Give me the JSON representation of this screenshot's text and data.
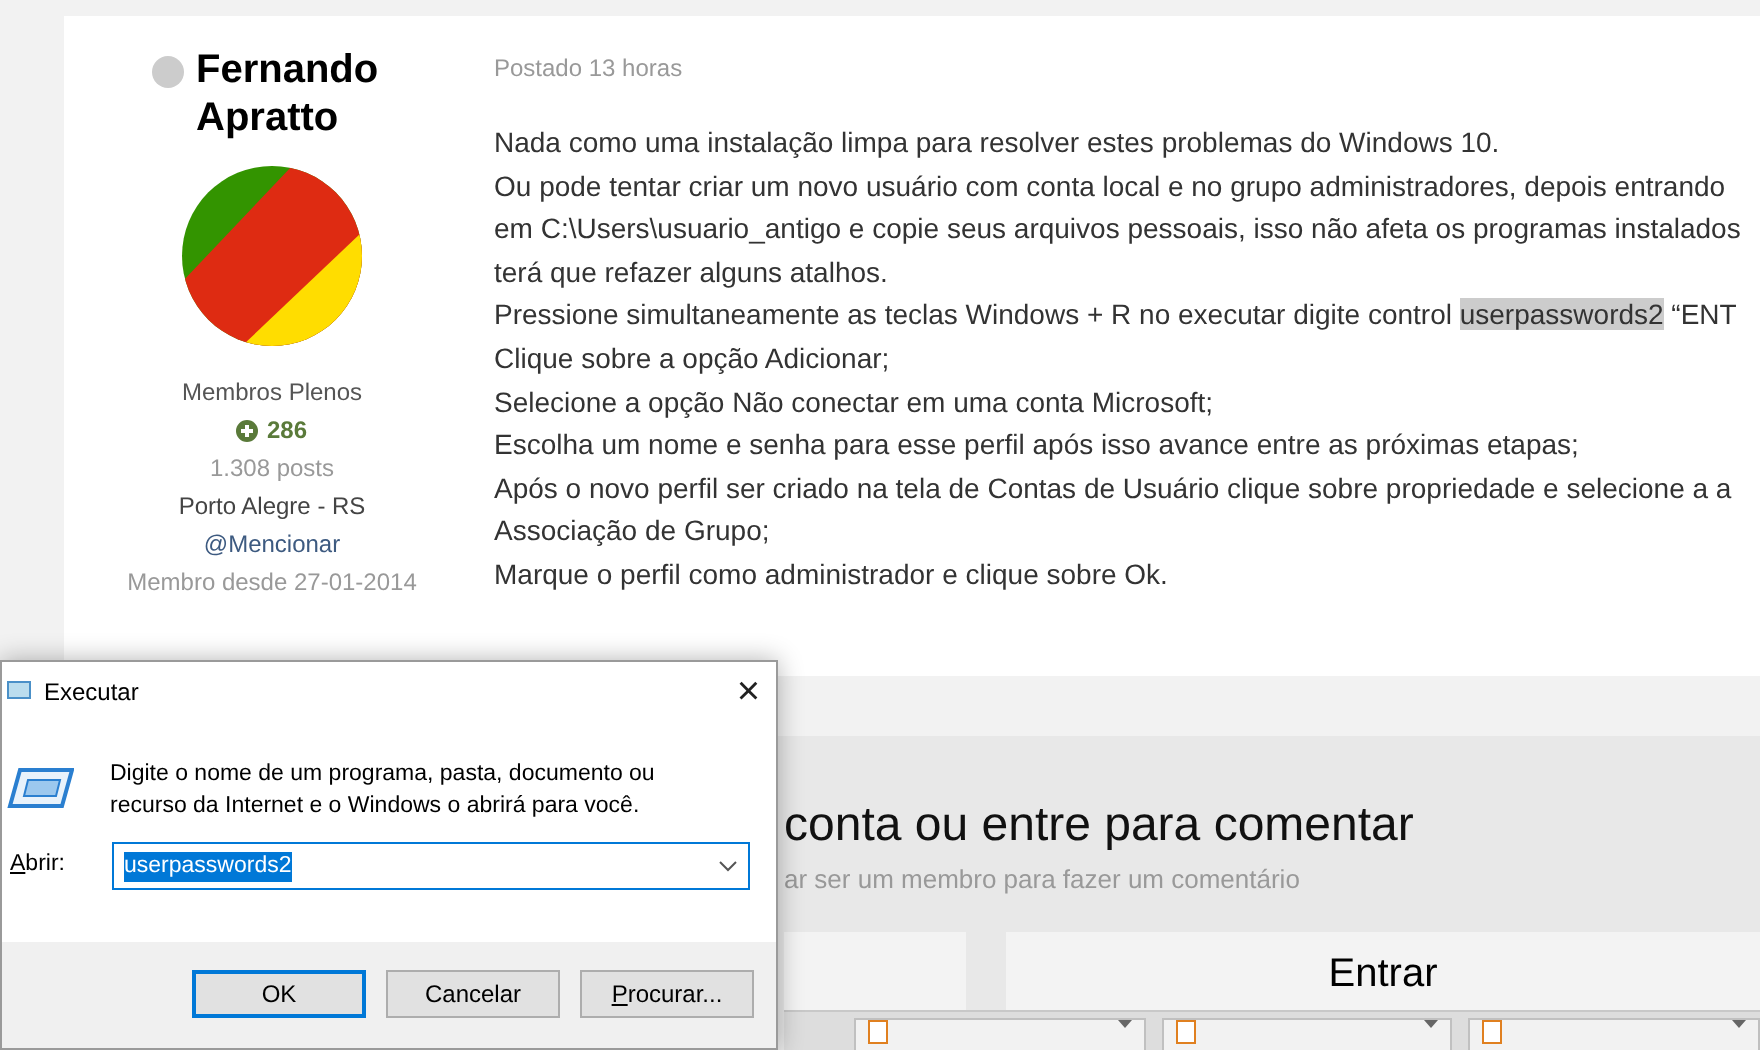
{
  "author": {
    "name": "Fernando Apratto",
    "group": "Membros Plenos",
    "reputation": "286",
    "posts": "1.308 posts",
    "location": "Porto Alegre - RS",
    "mention": "@Mencionar",
    "member_since": "Membro desde 27-01-2014"
  },
  "post": {
    "time": "Postado 13 horas",
    "lines": [
      [
        {
          "text": "Nada como uma instalação limpa para resolver estes problemas do Windows 10.",
          "highlighted": false
        }
      ],
      [
        {
          "text": "Ou pode tentar criar um novo usuário com conta local e no grupo administradores, depois entrando",
          "highlighted": false
        }
      ],
      [
        {
          "text": "em C:\\Users\\usuario_antigo e copie seus arquivos pessoais, isso não afeta os programas instalados",
          "highlighted": false
        }
      ],
      [
        {
          "text": "terá que refazer alguns atalhos.",
          "highlighted": false
        }
      ],
      [
        {
          "text": "Pressione simultaneamente as teclas Windows + R no executar digite control ",
          "highlighted": false
        },
        {
          "text": "userpasswords2",
          "highlighted": true
        },
        {
          "text": " “ENT",
          "highlighted": false
        }
      ],
      [
        {
          "text": "Clique sobre a opção Adicionar;",
          "highlighted": false
        }
      ],
      [
        {
          "text": "Selecione a opção Não conectar em uma conta Microsoft;",
          "highlighted": false
        }
      ],
      [
        {
          "text": "Escolha um nome e senha para esse perfil após isso avance entre as próximas etapas;",
          "highlighted": false
        }
      ],
      [
        {
          "text": "Após o novo perfil ser criado na tela de Contas de Usuário clique sobre propriedade e selecione a a",
          "highlighted": false
        }
      ],
      [
        {
          "text": "Associação de Grupo;",
          "highlighted": false
        }
      ],
      [
        {
          "text": "Marque o perfil como administrador e clique sobre Ok.",
          "highlighted": false
        }
      ]
    ]
  },
  "comment_area": {
    "heading": "conta ou entre para comentar",
    "subtitle": "ar ser um membro para fazer um comentário",
    "sign_in": "Entrar"
  },
  "run_dialog": {
    "title": "Executar",
    "close": "×",
    "description": "Digite o nome de um programa, pasta, documento ou recurso da Internet e o Windows o abrirá para você.",
    "open_label": "Abrir:",
    "value": "userpasswords2",
    "buttons": [
      {
        "label": "OK",
        "default": true
      },
      {
        "label": "Cancelar",
        "default": false
      },
      {
        "label": "Procurar...",
        "default": false
      }
    ]
  }
}
